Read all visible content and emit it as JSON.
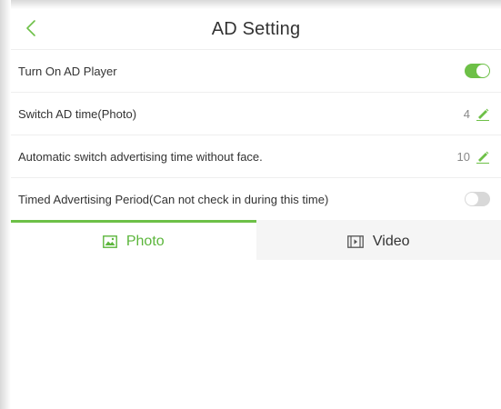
{
  "header": {
    "title": "AD Setting",
    "back_icon": "chevron-left-icon"
  },
  "settings": [
    {
      "label": "Turn On AD Player",
      "control": "toggle",
      "state": "on"
    },
    {
      "label": "Switch AD time(Photo)",
      "control": "edit",
      "value": "4"
    },
    {
      "label": "Automatic switch advertising time without face.",
      "control": "edit",
      "value": "10"
    },
    {
      "label": "Timed Advertising Period(Can not check in during this time)",
      "control": "toggle",
      "state": "off"
    }
  ],
  "tabs": [
    {
      "label": "Photo",
      "icon": "image-icon",
      "active": true
    },
    {
      "label": "Video",
      "icon": "film-icon",
      "active": false
    }
  ],
  "colors": {
    "accent": "#6dc047",
    "toggle_off": "#d8d8d8",
    "text": "#333333",
    "muted": "#888888"
  }
}
